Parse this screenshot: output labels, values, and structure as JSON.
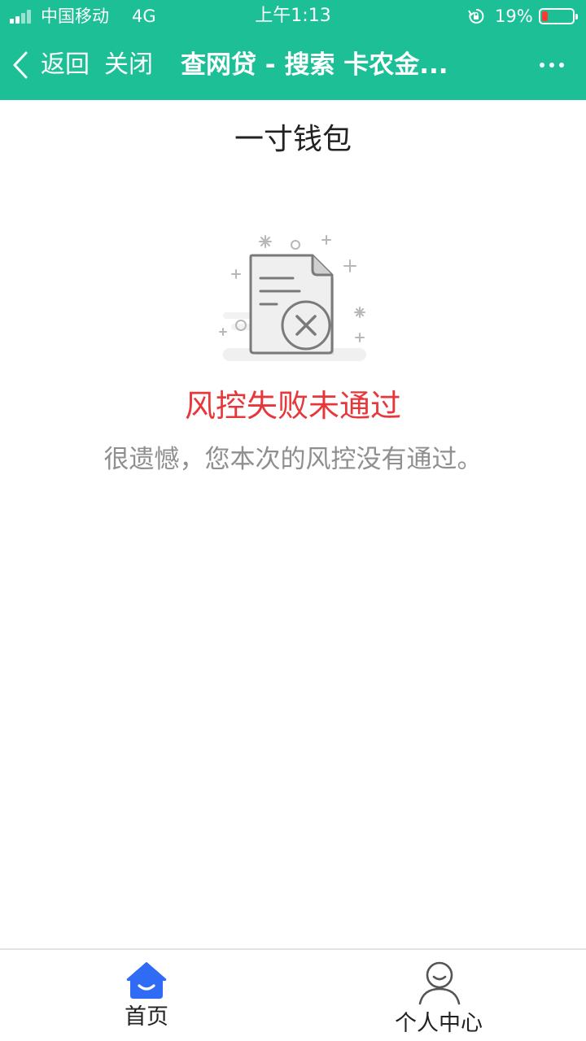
{
  "status_bar": {
    "carrier": "中国移动",
    "network": "4G",
    "time": "上午1:13",
    "battery_percent": "19%",
    "battery_level": 0.19,
    "icons": [
      "signal-icon",
      "rotation-lock-icon",
      "battery-icon"
    ]
  },
  "header": {
    "back_label": "返回",
    "close_label": "关闭",
    "title": "查网贷 - 搜索 卡农金...",
    "background_color": "#1dbf97",
    "icons": [
      "back-chevron-icon",
      "more-dots-icon"
    ]
  },
  "page": {
    "title": "一寸钱包"
  },
  "result": {
    "title": "风控失败未通过",
    "title_color": "#e8373b",
    "description": "很遗憾，您本次的风控没有通过。",
    "illustration_icon": "document-failed-icon"
  },
  "tabbar": {
    "items": [
      {
        "label": "首页",
        "icon": "home-icon",
        "active": true,
        "color": "#2f6bf5"
      },
      {
        "label": "个人中心",
        "icon": "user-icon",
        "active": false,
        "color": "#555555"
      }
    ]
  }
}
